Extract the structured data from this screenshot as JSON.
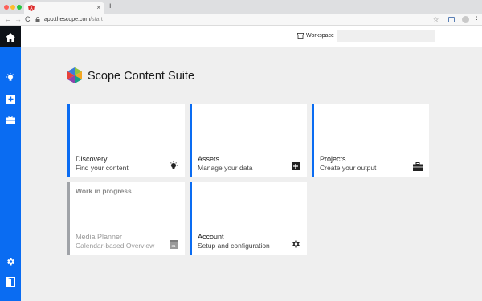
{
  "browser": {
    "tab_close": "×",
    "new_tab": "+",
    "url_host": "app.thescope.com",
    "url_path": "/start",
    "back": "←",
    "forward": "→",
    "reload": "C",
    "bookmark": "☆",
    "menu": "⋮"
  },
  "header": {
    "workspace_label": "Workspace",
    "workspace_value": ""
  },
  "brand": {
    "title": "Scope Content Suite"
  },
  "cards": {
    "discovery": {
      "title": "Discovery",
      "subtitle": "Find your content",
      "icon": "lightbulb-icon"
    },
    "assets": {
      "title": "Assets",
      "subtitle": "Manage your data",
      "icon": "plus-box-icon"
    },
    "projects": {
      "title": "Projects",
      "subtitle": "Create your output",
      "icon": "briefcase-icon"
    },
    "media_planner": {
      "heading": "Work in progress",
      "title": "Media Planner",
      "subtitle": "Calendar-based Overview",
      "calendar_day": "31",
      "icon": "calendar-icon"
    },
    "account": {
      "title": "Account",
      "subtitle": "Setup and configuration",
      "icon": "gear-icon"
    }
  },
  "colors": {
    "accent": "#0a6cf2",
    "sidebar_home": "#0d1117",
    "wip_border": "#a0a3a8",
    "background": "#efefef"
  }
}
